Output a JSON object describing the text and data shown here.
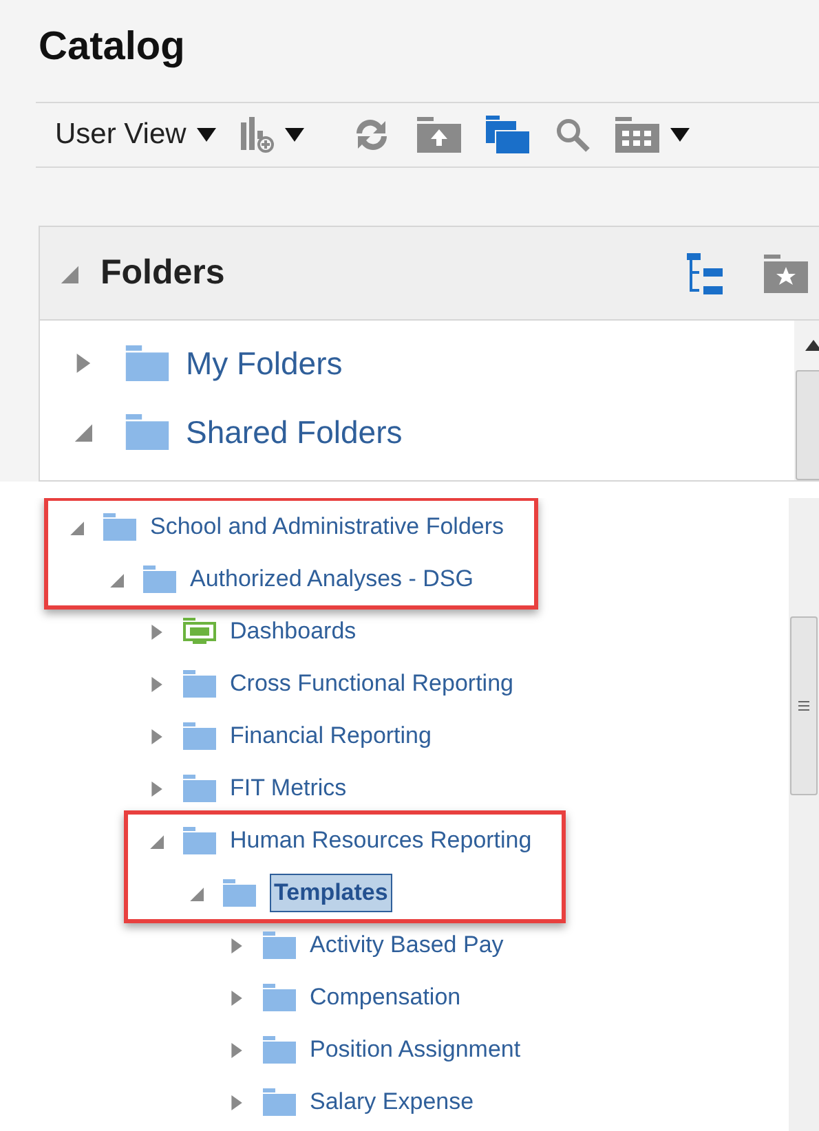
{
  "title": "Catalog",
  "toolbar": {
    "view_menu": "User View"
  },
  "folders_panel": {
    "title": "Folders",
    "tree": [
      {
        "label": "My Folders",
        "expanded": false,
        "selected": false
      },
      {
        "label": "Shared Folders",
        "expanded": true,
        "selected": false
      }
    ]
  },
  "detail_tree": [
    {
      "label": "School and Administrative Folders",
      "kind": "folder",
      "expanded": true,
      "selected": false,
      "highlighted": true,
      "children": [
        {
          "label": "Authorized Analyses - DSG",
          "kind": "folder",
          "expanded": true,
          "selected": false,
          "highlighted": true,
          "children": [
            {
              "label": "Dashboards",
              "kind": "dashboard",
              "expanded": false,
              "selected": false,
              "highlighted": false
            },
            {
              "label": "Cross Functional Reporting",
              "kind": "folder",
              "expanded": false,
              "selected": false,
              "highlighted": false
            },
            {
              "label": "Financial Reporting",
              "kind": "folder",
              "expanded": false,
              "selected": false,
              "highlighted": false
            },
            {
              "label": "FIT Metrics",
              "kind": "folder",
              "expanded": false,
              "selected": false,
              "highlighted": false
            },
            {
              "label": "Human Resources Reporting",
              "kind": "folder",
              "expanded": true,
              "selected": false,
              "highlighted": true,
              "children": [
                {
                  "label": "Templates",
                  "kind": "folder",
                  "expanded": true,
                  "selected": true,
                  "highlighted": true,
                  "children": [
                    {
                      "label": "Activity Based Pay",
                      "kind": "folder",
                      "expanded": false,
                      "selected": false,
                      "highlighted": false
                    },
                    {
                      "label": "Compensation",
                      "kind": "folder",
                      "expanded": false,
                      "selected": false,
                      "highlighted": false
                    },
                    {
                      "label": "Position Assignment",
                      "kind": "folder",
                      "expanded": false,
                      "selected": false,
                      "highlighted": false
                    },
                    {
                      "label": "Salary Expense",
                      "kind": "folder",
                      "expanded": false,
                      "selected": false,
                      "highlighted": false
                    }
                  ]
                }
              ]
            }
          ]
        }
      ]
    }
  ]
}
